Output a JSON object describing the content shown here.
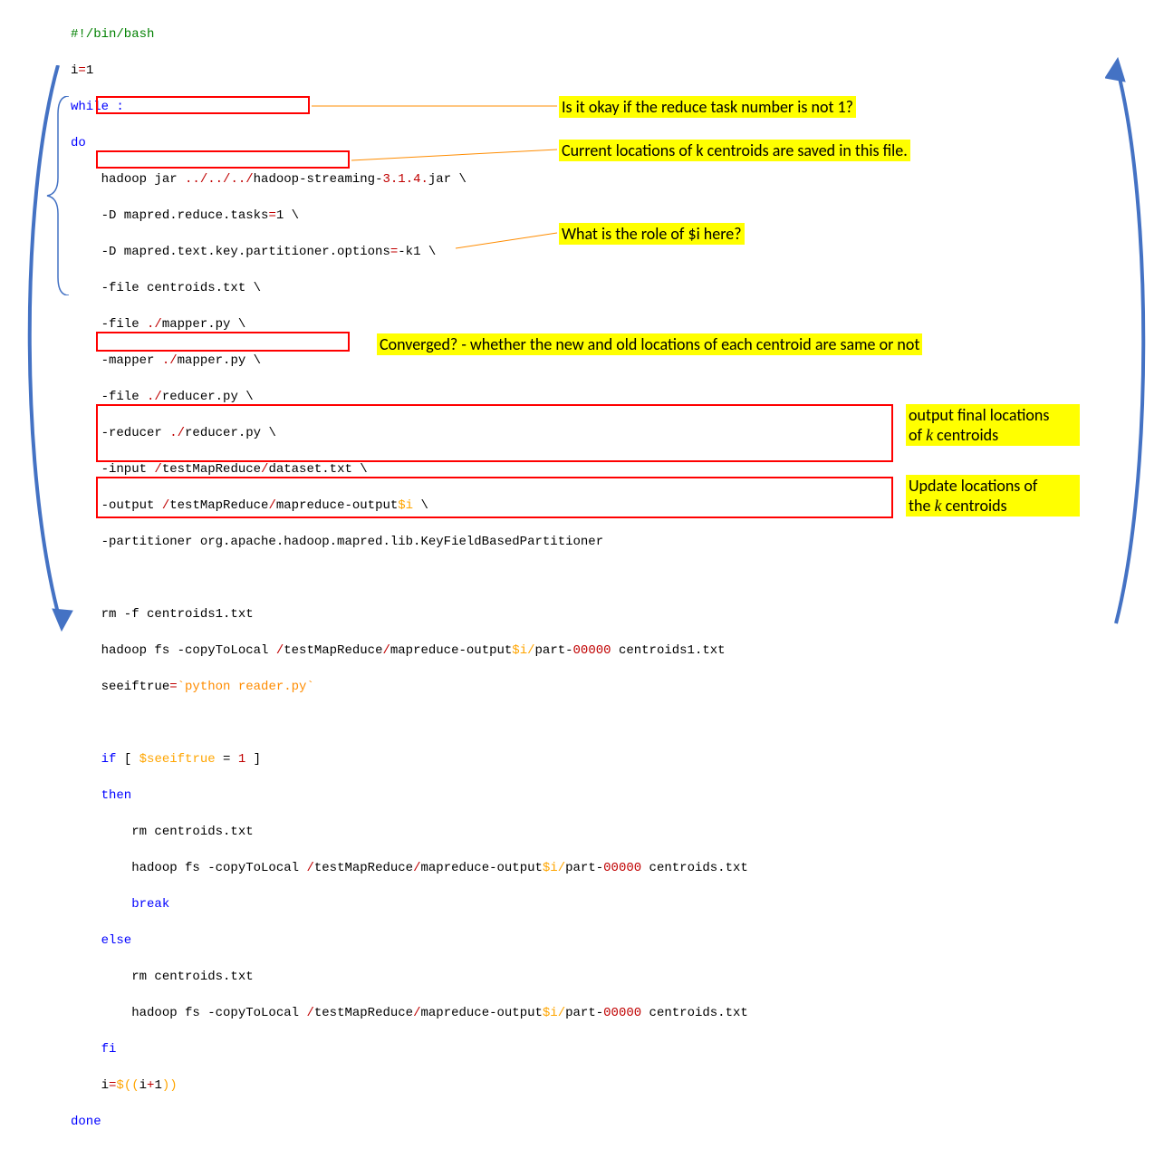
{
  "code": {
    "shebang": "#!/bin/bash",
    "l2_a": "i",
    "l2_b": "=",
    "l2_c": "1",
    "l3": "while :",
    "l4": "do",
    "l5_indent": "    ",
    "l5_a": "hadoop jar ",
    "l5_b": "../../../",
    "l5_c": "hadoop-streaming-",
    "l5_d": "3.1.4.",
    "l5_e": "jar \\",
    "l6_a": "    -D mapred.reduce.tasks",
    "l6_b": "=",
    "l6_c": "1 \\",
    "l7_a": "    -D mapred.text.key.partitioner.options",
    "l7_b": "=",
    "l7_c": "-k1 \\",
    "l8": "    -file centroids.txt \\",
    "l9_a": "    -file ",
    "l9_b": "./",
    "l9_c": "mapper.py \\",
    "l10_a": "    -mapper ",
    "l10_b": "./",
    "l10_c": "mapper.py \\",
    "l11_a": "    -file ",
    "l11_b": "./",
    "l11_c": "reducer.py \\",
    "l12_a": "    -reducer ",
    "l12_b": "./",
    "l12_c": "reducer.py \\",
    "l13_a": "    -input ",
    "l13_b": "/",
    "l13_c": "testMapReduce",
    "l13_d": "/",
    "l13_e": "dataset.txt \\",
    "l14_a": "    -output ",
    "l14_b": "/",
    "l14_c": "testMapReduce",
    "l14_d": "/",
    "l14_e": "mapreduce-output",
    "l14_f": "$i",
    "l14_g": " \\",
    "l15": "    -partitioner org.apache.hadoop.mapred.lib.KeyFieldBasedPartitioner",
    "l16": "",
    "l17": "    rm -f centroids1.txt",
    "l18_a": "    hadoop fs -copyToLocal ",
    "l18_b": "/",
    "l18_c": "testMapReduce",
    "l18_d": "/",
    "l18_e": "mapreduce-output",
    "l18_f": "$i/",
    "l18_g": "part-",
    "l18_h": "00000",
    "l18_i": " centroids1.txt",
    "l19_a": "    seeiftrue",
    "l19_b": "=",
    "l19_c": "`python reader.py`",
    "l20": "",
    "l21_a": "    if",
    "l21_b": " [ ",
    "l21_c": "$seeiftrue",
    "l21_d": " = ",
    "l21_e": "1",
    "l21_f": " ]",
    "l22": "    then",
    "l23": "        rm centroids.txt",
    "l24_a": "        hadoop fs -copyToLocal ",
    "l24_b": "/",
    "l24_c": "testMapReduce",
    "l24_d": "/",
    "l24_e": "mapreduce-output",
    "l24_f": "$i/",
    "l24_g": "part-",
    "l24_h": "00000",
    "l24_i": " centroids.txt",
    "l25": "        break",
    "l26": "    else",
    "l27": "        rm centroids.txt",
    "l28_a": "        hadoop fs -copyToLocal ",
    "l28_b": "/",
    "l28_c": "testMapReduce",
    "l28_d": "/",
    "l28_e": "mapreduce-output",
    "l28_f": "$i/",
    "l28_g": "part-",
    "l28_h": "00000",
    "l28_i": " centroids.txt",
    "l29": "    fi",
    "l30_a": "    i",
    "l30_b": "=",
    "l30_c": "$((",
    "l30_d": "i",
    "l30_e": "+",
    "l30_f": "1",
    "l30_g": "))",
    "l31": "done"
  },
  "annotations": {
    "reduce_q": "Is it okay if the reduce task number is not 1?",
    "centroids_note": "Current locations of k centroids are saved in this file.",
    "role_i": "What is the role of $i here?",
    "converged": "Converged? - whether the new and old locations of each centroid are same or not",
    "output_final_1": "output final locations",
    "output_final_2_pre": "of ",
    "output_final_2_k": "k",
    "output_final_2_post": " centroids",
    "update_1": "Update locations of",
    "update_2_pre": "the ",
    "update_2_k": "k",
    "update_2_post": " centroids"
  }
}
